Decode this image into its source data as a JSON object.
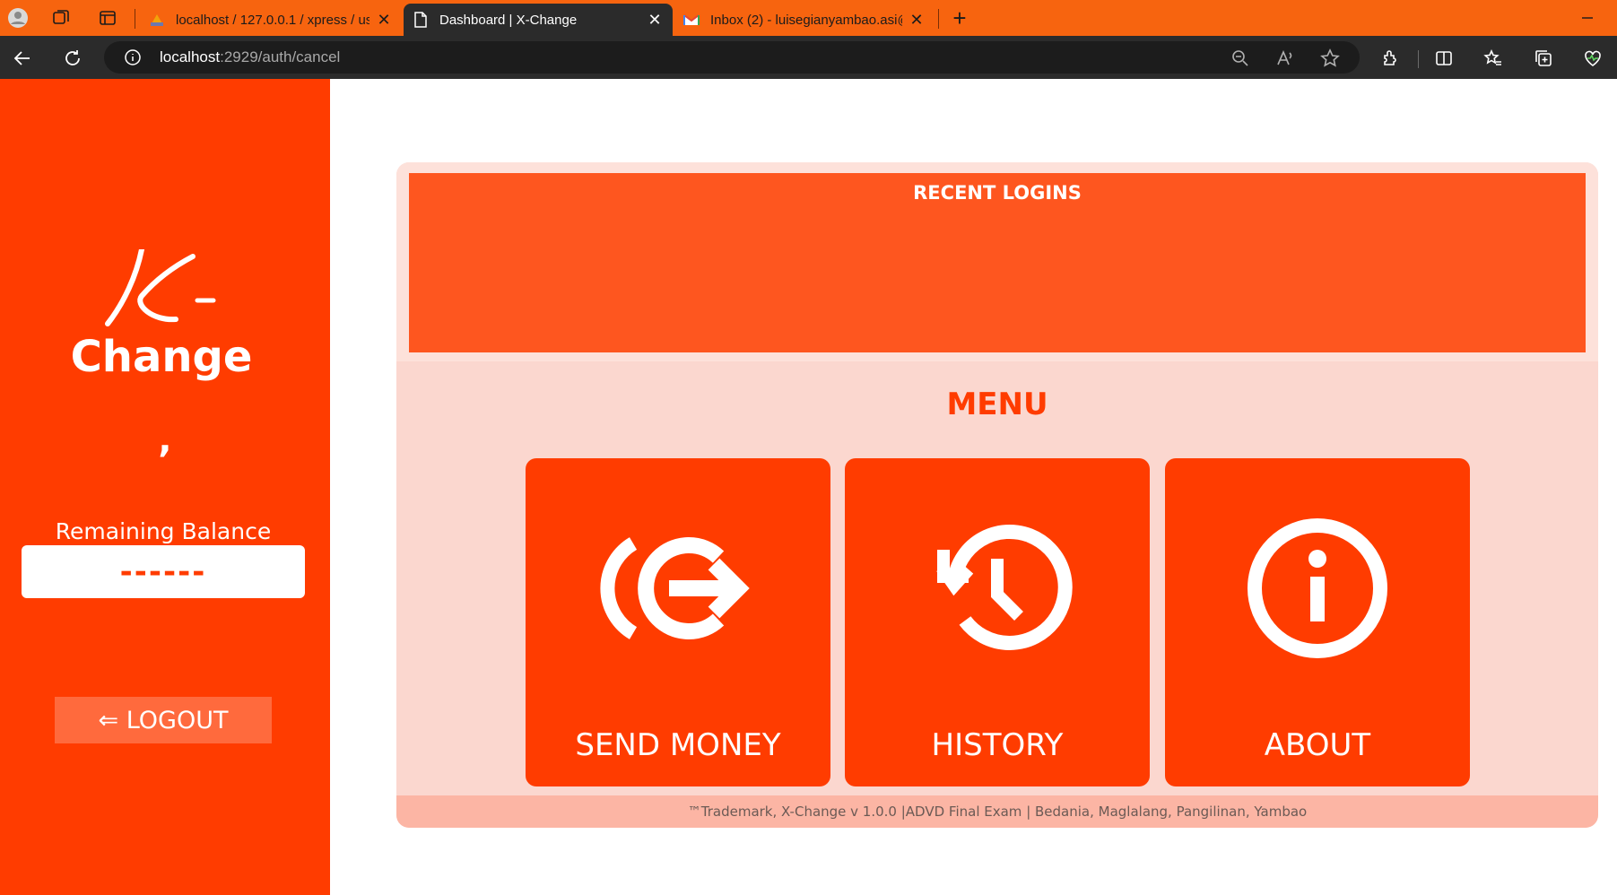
{
  "browser": {
    "tabs": [
      {
        "title": "localhost / 127.0.0.1 / xpress / us",
        "favicon": "phpmyadmin-icon",
        "active": false
      },
      {
        "title": "Dashboard | X-Change",
        "favicon": "page-icon",
        "active": true
      },
      {
        "title": "Inbox (2) - luisegianyambao.asi@",
        "favicon": "gmail-icon",
        "active": false
      }
    ],
    "url_host": "localhost",
    "url_path": ":2929/auth/cancel",
    "chrome_color": "#f7640f",
    "toolbar_color": "#2b2b2b"
  },
  "sidebar": {
    "logo_top": "X",
    "logo_bottom": "Change",
    "user_name": ",",
    "balance_label": "Remaining Balance",
    "balance_value": "------",
    "logout_label": "⇐ LOGOUT"
  },
  "main": {
    "recent_logins_title": "RECENT LOGINS",
    "menu_title": "MENU",
    "menu_items": [
      {
        "label": "SEND MONEY",
        "icon": "send-money-icon"
      },
      {
        "label": "HISTORY",
        "icon": "history-icon"
      },
      {
        "label": "ABOUT",
        "icon": "info-icon"
      }
    ],
    "footer": "™Trademark, X-Change v 1.0.0 |ADVD Final Exam | Bedania, Maglalang, Pangilinan, Yambao"
  },
  "colors": {
    "brand": "#ff3c00",
    "recent_panel": "#fe561f",
    "card_bg": "#fbd7cf",
    "footer_bg": "#fcb5a4"
  }
}
